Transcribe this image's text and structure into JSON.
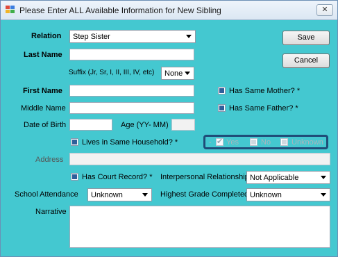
{
  "window": {
    "title": "Please Enter ALL Available Information for New Sibling",
    "close_glyph": "✕"
  },
  "relation": {
    "label": "Relation",
    "value": "Step Sister"
  },
  "last_name": {
    "label": "Last Name",
    "value": ""
  },
  "suffix": {
    "label": "Suffix (Jr, Sr, I, II, III, IV, etc)",
    "value": "None"
  },
  "first_name": {
    "label": "First Name",
    "value": ""
  },
  "middle_name": {
    "label": "Middle Name",
    "value": ""
  },
  "dob": {
    "label": "Date of Birth",
    "value": ""
  },
  "age": {
    "label": "Age (YY- MM)",
    "value": ""
  },
  "has_same_mother": {
    "label": "Has Same Mother? *"
  },
  "has_same_father": {
    "label": "Has Same Father? *"
  },
  "lives_in_household": {
    "label": "Lives in Same Household? *"
  },
  "household_options": {
    "dash": "-",
    "yes": "Yes",
    "no": "No",
    "unknown": "Unknown"
  },
  "address": {
    "label": "Address",
    "value": ""
  },
  "court_record": {
    "label": "Has Court Record? *"
  },
  "interpersonal": {
    "label": "Interpersonal Relationship",
    "value": "Not Applicable"
  },
  "school_attendance": {
    "label": "School Attendance",
    "value": "Unknown"
  },
  "highest_grade": {
    "label": "Highest Grade Completed",
    "value": "Unknown"
  },
  "narrative": {
    "label": "Narrative",
    "value": ""
  },
  "buttons": {
    "save": "Save",
    "cancel": "Cancel"
  },
  "colors": {
    "background": "#44c8d0",
    "highlight_border": "#1f4d78"
  }
}
